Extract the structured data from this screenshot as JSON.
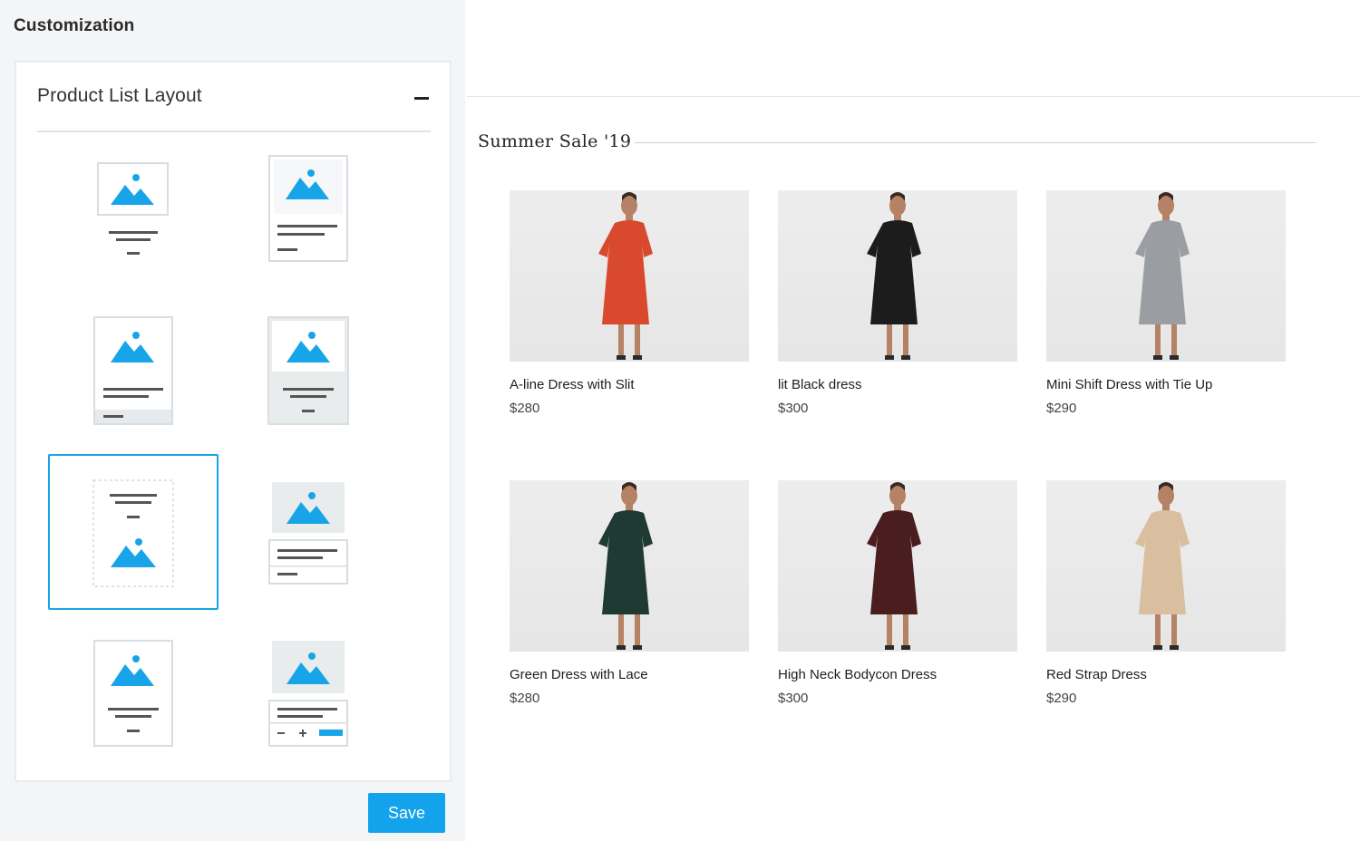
{
  "sidebar": {
    "title": "Customization",
    "panel": {
      "title": "Product List Layout",
      "collapse_icon": "minus-icon",
      "selected_layout": 5
    },
    "save_label": "Save"
  },
  "colors": {
    "accent": "#12a3ec",
    "icon_blue": "#18a4e8",
    "sidebar_bg": "#f4f5f7"
  },
  "preview": {
    "section_title": "Summer Sale '19",
    "products": [
      {
        "name": "A-line Dress with Slit",
        "price": "$280",
        "dress_color": "#d9492e",
        "image": "red-floral-dress-photo"
      },
      {
        "name": "lit Black dress",
        "price": "$300",
        "dress_color": "#1c1c1c",
        "image": "black-dress-photo"
      },
      {
        "name": "Mini Shift Dress with Tie Up",
        "price": "$290",
        "dress_color": "#9a9ea3",
        "image": "grey-shift-dress-photo"
      },
      {
        "name": "Green Dress with Lace",
        "price": "$280",
        "dress_color": "#1f3a33",
        "image": "green-dress-photo"
      },
      {
        "name": "High Neck Bodycon Dress",
        "price": "$300",
        "dress_color": "#4a1d1f",
        "image": "burgundy-dress-photo"
      },
      {
        "name": "Red Strap Dress",
        "price": "$290",
        "dress_color": "#d9bea0",
        "image": "beige-strap-dress-photo"
      }
    ]
  }
}
